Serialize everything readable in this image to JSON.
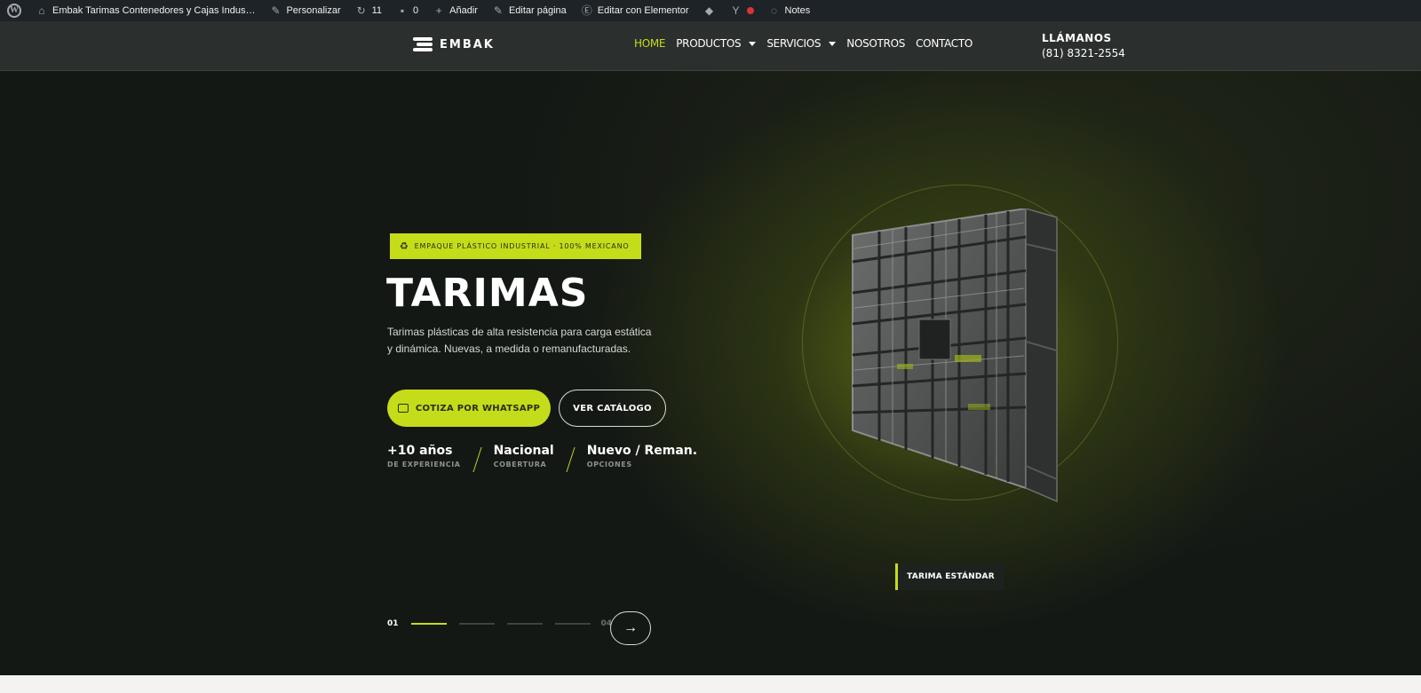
{
  "adminbar": {
    "site_name": "Embak Tarimas Contenedores y Cajas Indus…",
    "customize": "Personalizar",
    "updates": "11",
    "comments": "0",
    "add_new": "Añadir",
    "edit_page": "Editar página",
    "edit_elementor": "Editar con Elementor",
    "notes": "Notes"
  },
  "header": {
    "logo_text": "EMBAK",
    "nav": [
      {
        "label": "HOME",
        "active": true
      },
      {
        "label": "PRODUCTOS",
        "dropdown": true
      },
      {
        "label": "SERVICIOS",
        "dropdown": true
      },
      {
        "label": "NOSOTROS"
      },
      {
        "label": "CONTACTO"
      }
    ],
    "call_label": "LLÁMANOS",
    "phone": "(81) 8321-2554"
  },
  "hero": {
    "badge": "EMPAQUE PLÁSTICO INDUSTRIAL · 100% MEXICANO",
    "title": "TARIMAS",
    "description": "Tarimas plásticas de alta resistencia para carga estática y dinámica. Nuevas, a medida o remanufacturadas.",
    "btn_whatsapp": "COTIZA POR WHATSAPP",
    "btn_catalog": "VER CATÁLOGO",
    "stats": [
      {
        "value": "+10 años",
        "label": "DE EXPERIENCIA"
      },
      {
        "value": "Nacional",
        "label": "COBERTURA"
      },
      {
        "value": "Nuevo / Reman.",
        "label": "OPCIONES"
      }
    ],
    "product_tag": "TARIMA ESTÁNDAR",
    "slide_current": "01",
    "slide_total": "04",
    "accent_color": "#c5dc1a"
  },
  "icons": {
    "next": "arrow-right-icon",
    "whatsapp": "chat-icon",
    "badge": "recycle-icon"
  }
}
